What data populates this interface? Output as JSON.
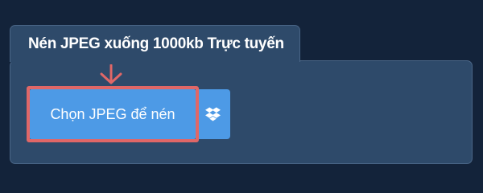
{
  "panel": {
    "title": "Nén JPEG xuống 1000kb Trực tuyến"
  },
  "upload": {
    "choose_label": "Chọn JPEG để nén",
    "dropbox_icon": "dropbox-icon"
  },
  "colors": {
    "page_background": "#13233a",
    "panel_background": "#2e4a6a",
    "button_blue": "#4d9ae6",
    "highlight_red": "#e06767"
  }
}
